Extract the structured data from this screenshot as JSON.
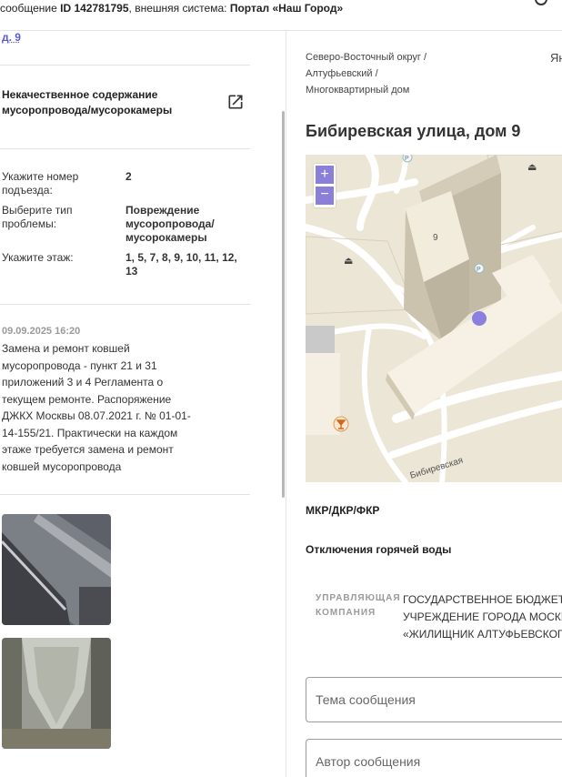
{
  "header": {
    "prefix": "сообщение",
    "id_label": "ID 142781795",
    "middle": ", внешняя система:",
    "system": "Портал «Наш Город»"
  },
  "left": {
    "house_link": "д. 9",
    "category": "Некачественное содержание мусоропровода/мусорокамеры",
    "fields": [
      {
        "label": "Укажите номер подъезда:",
        "value": "2"
      },
      {
        "label": "Выберите тип проблемы:",
        "value": "Повреждение мусоропровода/ мусорокамеры"
      },
      {
        "label": "Укажите этаж:",
        "value": "1, 5, 7, 8, 9, 10, 11, 12, 13"
      }
    ],
    "comment": {
      "date": "09.09.2025 16:20",
      "text": "Замена и ремонт ковшей мусоропровода - пункт 21 и 31 приложений 3 и 4 Регламента о текущем ремонте. Распоряжение ДЖКХ Москвы 08.07.2021 г. № 01-01-14-155/21. Практически на каждом этаже требуется замена и ремонт ковшей мусоропровода"
    }
  },
  "right": {
    "breadcrumb": [
      "Северо-Восточный округ /",
      "Алтуфьевский /",
      "Многоквартирный дом"
    ],
    "lang": "Ян",
    "address": "Бибиревская улица, дом 9",
    "map": {
      "zoom_in": "+",
      "zoom_out": "−",
      "building_number": "9",
      "street_label": "Бибиревская",
      "parking": "P"
    },
    "sections": [
      "МКР/ДКР/ФКР",
      "Отключения горячей воды"
    ],
    "management": {
      "label": "УПРАВЛЯЮЩАЯ КОМПАНИЯ",
      "lines": [
        "ГОСУДАРСТВЕННОЕ БЮДЖЕТНОЕ",
        "УЧРЕЖДЕНИЕ ГОРОДА МОСКВЫ",
        "«ЖИЛИЩНИК АЛТУФЬЕВСКОГО»"
      ]
    },
    "inputs": {
      "subject_placeholder": "Тема сообщения",
      "author_placeholder": "Автор сообщения"
    }
  },
  "colors": {
    "link": "#5a5ad1",
    "marker": "#8b7fe0",
    "map_bg": "#ece6d6"
  }
}
